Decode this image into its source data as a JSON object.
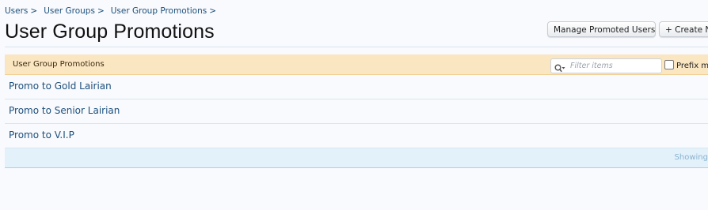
{
  "breadcrumb": {
    "items": [
      "Users",
      "User Groups",
      "User Group Promotions"
    ],
    "separator": ">"
  },
  "header": {
    "title": "User Group Promotions",
    "buttons": {
      "manage_label": "Manage Promoted Users",
      "create_label": "+ Create Ne"
    }
  },
  "list": {
    "header_label": "User Group Promotions",
    "filter": {
      "placeholder": "Filter items",
      "icon": "search-icon"
    },
    "prefix_label": "Prefix m",
    "items": [
      "Promo to Gold Lairian",
      "Promo to Senior Lairian",
      "Promo to V.I.P"
    ],
    "footer_text": "Showing"
  },
  "colors": {
    "link": "#1d4f7c",
    "header_bg": "#fbe6c2",
    "footer_bg": "#e3f1fb"
  }
}
